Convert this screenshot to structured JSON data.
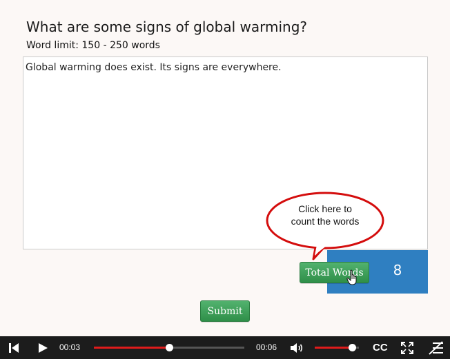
{
  "question": {
    "title": "What are some signs of global warming?",
    "word_limit": "Word limit: 150 - 250 words"
  },
  "answer": {
    "value": "Global warming does exist. Its signs are everywhere."
  },
  "callout": {
    "text": "Click here to\ncount the words"
  },
  "word_count": {
    "button_label": "Total Words",
    "value": "8"
  },
  "submit": {
    "label": "Submit"
  },
  "player": {
    "elapsed": "00:03",
    "duration": "00:06",
    "progress_fraction": 0.5,
    "volume_fraction": 0.85,
    "captions_label": "CC",
    "icons": [
      "skip-back-icon",
      "play-icon",
      "volume-icon",
      "fullscreen-icon",
      "menu-icon"
    ],
    "accent_color": "#e01b1b"
  }
}
